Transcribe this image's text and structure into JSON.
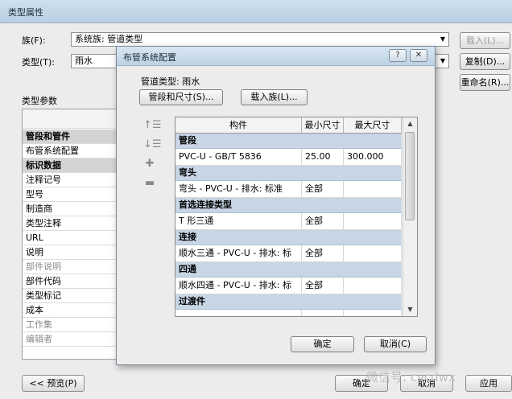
{
  "outer": {
    "title": "类型属性",
    "family_label": "族(F):",
    "family_value": "系统族: 管道类型",
    "type_label": "类型(T):",
    "type_value": "雨水",
    "load_button": "载入(L)...",
    "duplicate_button": "复制(D)...",
    "rename_button": "重命名(R)...",
    "params_label": "类型参数",
    "param_rows": [
      {
        "label": "管段和管件",
        "group": true
      },
      {
        "label": "布管系统配置",
        "group": false
      },
      {
        "label": "标识数据",
        "group": true
      },
      {
        "label": "注释记号",
        "group": false
      },
      {
        "label": "型号",
        "group": false
      },
      {
        "label": "制造商",
        "group": false
      },
      {
        "label": "类型注释",
        "group": false
      },
      {
        "label": "URL",
        "group": false
      },
      {
        "label": "说明",
        "group": false
      },
      {
        "label": "部件说明",
        "group": false,
        "dim": true
      },
      {
        "label": "部件代码",
        "group": false
      },
      {
        "label": "类型标记",
        "group": false
      },
      {
        "label": "成本",
        "group": false
      },
      {
        "label": "工作集",
        "group": false,
        "dim": true
      },
      {
        "label": "编辑者",
        "group": false,
        "dim": true
      }
    ],
    "preview_button": "<< 预览(P)",
    "ok_button": "确定",
    "cancel_button": "取消",
    "apply_button": "应用"
  },
  "dialog": {
    "title": "布管系统配置",
    "help_button": "?",
    "close_button": "✕",
    "pipe_type_label": "管道类型: 雨水",
    "segments_button": "管段和尺寸(S)...",
    "load_family_button": "载入族(L)...",
    "columns": [
      "构件",
      "最小尺寸",
      "最大尺寸"
    ],
    "rows": [
      {
        "section": "管段"
      },
      {
        "cells": [
          "PVC-U - GB/T 5836",
          "25.00",
          "300.000"
        ]
      },
      {
        "section": "弯头"
      },
      {
        "cells": [
          "弯头 - PVC-U - 排水: 标准",
          "全部",
          ""
        ]
      },
      {
        "section": "首选连接类型"
      },
      {
        "cells": [
          "T 形三通",
          "全部",
          ""
        ]
      },
      {
        "section": "连接"
      },
      {
        "cells": [
          "顺水三通 - PVC-U - 排水: 标",
          "全部",
          ""
        ]
      },
      {
        "section": "四通"
      },
      {
        "cells": [
          "顺水四通 - PVC-U - 排水: 标",
          "全部",
          ""
        ]
      },
      {
        "section": "过渡件"
      },
      {
        "cells": [
          "",
          "",
          ""
        ]
      }
    ],
    "ok_button": "确定",
    "cancel_button": "取消(C)"
  },
  "icons": {
    "move_up": "move-up-icon",
    "move_down": "move-down-icon",
    "add_row": "add-row-icon",
    "remove_row": "remove-row-icon"
  },
  "watermark": "微信号: cvcdwx"
}
